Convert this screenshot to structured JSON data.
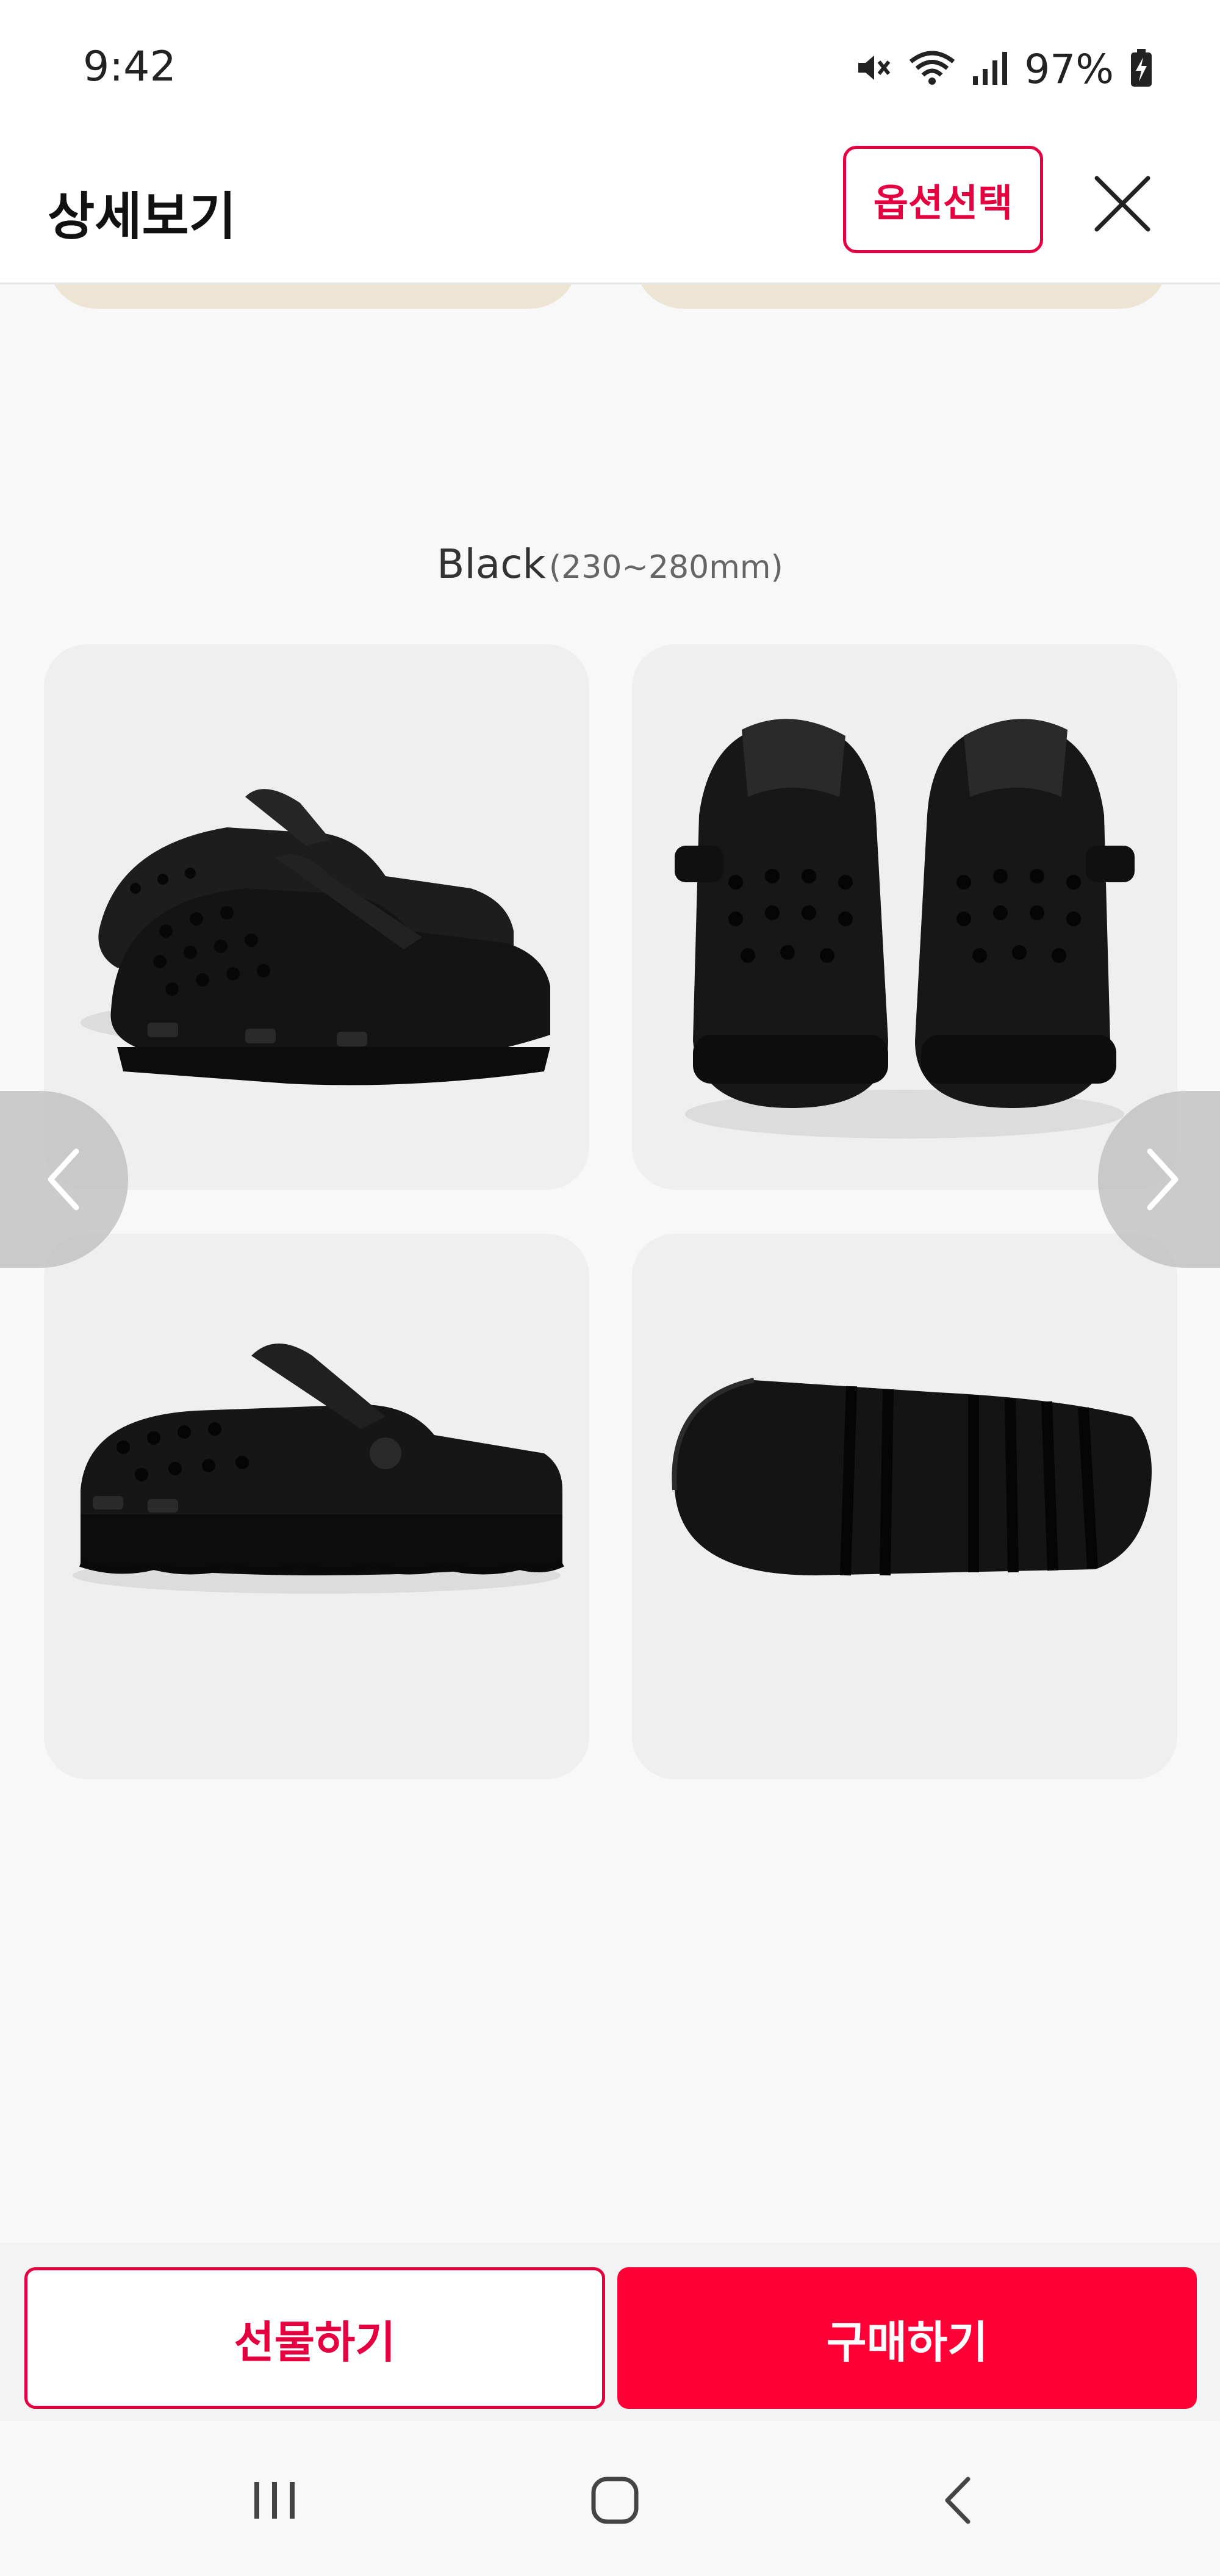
{
  "status_bar": {
    "time": "9:42",
    "battery_percent": "97%",
    "icons": [
      "mute-icon",
      "wifi-icon",
      "signal-icon",
      "battery-charging-icon"
    ]
  },
  "header": {
    "title": "상세보기",
    "option_button_label": "옵션선택",
    "close_icon": "close-icon"
  },
  "product": {
    "variant_name": "Black",
    "variant_size": "(230~280mm)",
    "images": [
      {
        "view": "angled-pair"
      },
      {
        "view": "front-pair"
      },
      {
        "view": "side"
      },
      {
        "view": "sole"
      }
    ]
  },
  "carousel": {
    "prev_icon": "chevron-left-icon",
    "next_icon": "chevron-right-icon"
  },
  "actions": {
    "gift_label": "선물하기",
    "buy_label": "구매하기"
  },
  "navigation": {
    "recents_icon": "recents-icon",
    "home_icon": "home-icon",
    "back_icon": "back-icon"
  },
  "colors": {
    "accent": "#ff0036",
    "accent_border": "#e5003f",
    "card_bg": "#efefef",
    "content_bg": "#f8f8f8",
    "top_card": "#ede4d3"
  }
}
